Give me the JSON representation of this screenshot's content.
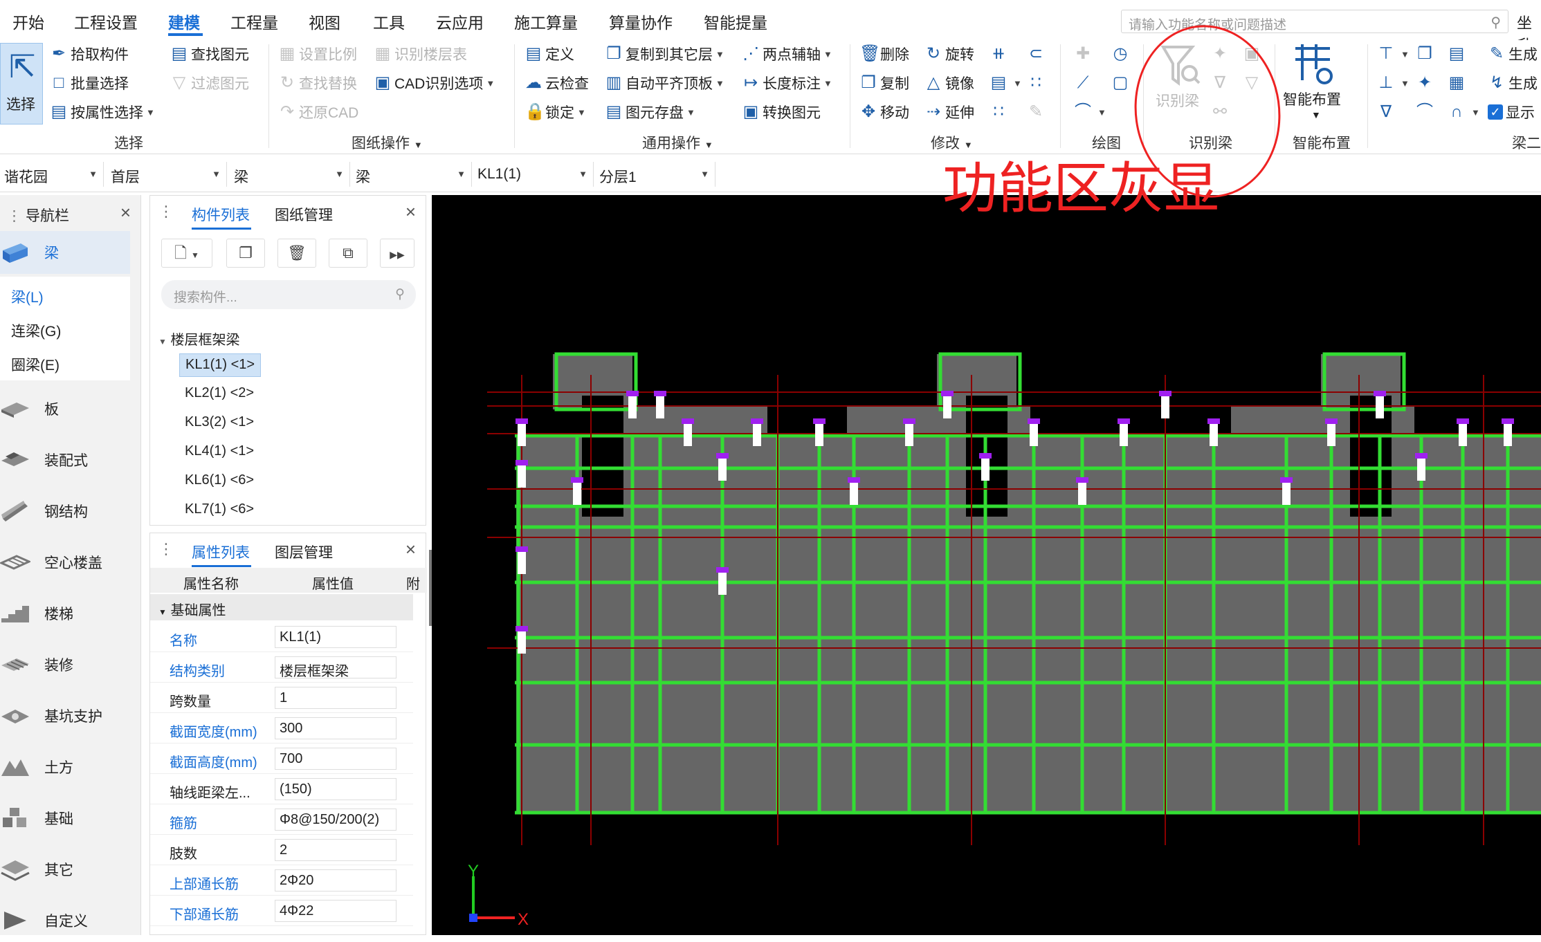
{
  "menu": {
    "items": [
      "开始",
      "工程设置",
      "建模",
      "工程量",
      "视图",
      "工具",
      "云应用",
      "施工算量",
      "算量协作",
      "智能提量"
    ],
    "active_index": 2,
    "search_placeholder": "请输入功能名称或问题描述",
    "right_label": "坐升"
  },
  "ribbon": {
    "select_group": {
      "big_button": "选择",
      "buttons": [
        "拾取构件",
        "批量选择",
        "按属性选择"
      ],
      "label": "选择"
    },
    "find_group": {
      "buttons": [
        "查找图元",
        "过滤图元"
      ]
    },
    "drawing_group": {
      "buttons": [
        "设置比例",
        "识别楼层表",
        "查找替换",
        "CAD识别选项",
        "还原CAD"
      ],
      "label": "图纸操作"
    },
    "common_group": {
      "buttons": [
        "定义",
        "复制到其它层",
        "两点辅轴",
        "云检查",
        "自动平齐顶板",
        "长度标注",
        "锁定",
        "图元存盘",
        "转换图元"
      ],
      "label": "通用操作"
    },
    "modify_group": {
      "buttons": [
        "删除",
        "旋转",
        "复制",
        "镜像",
        "移动",
        "延伸"
      ],
      "label": "修改"
    },
    "draw_group": {
      "label": "绘图"
    },
    "recognize_group": {
      "big_button": "识别梁",
      "label": "识别梁"
    },
    "smart_group": {
      "big_button": "智能布置",
      "label": "智能布置"
    },
    "beam2_group": {
      "buttons": [
        "生成",
        "生成",
        "显示"
      ],
      "label": "梁二"
    }
  },
  "selectors": [
    "谐花园",
    "首层",
    "梁",
    "梁",
    "KL1(1)",
    "分层1"
  ],
  "nav": {
    "title": "导航栏",
    "items": [
      "梁",
      "板",
      "装配式",
      "钢结构",
      "空心楼盖",
      "楼梯",
      "装修",
      "基坑支护",
      "土方",
      "基础",
      "其它",
      "自定义"
    ],
    "sub_items": [
      "梁(L)",
      "连梁(G)",
      "圈梁(E)"
    ]
  },
  "component_list": {
    "tabs": [
      "构件列表",
      "图纸管理"
    ],
    "search_placeholder": "搜索构件...",
    "tree_root": "楼层框架梁",
    "items": [
      "KL1(1) <1>",
      "KL2(1) <2>",
      "KL3(2) <1>",
      "KL4(1) <1>",
      "KL6(1) <6>",
      "KL7(1) <6>"
    ],
    "selected_index": 0
  },
  "property_list": {
    "tabs": [
      "属性列表",
      "图层管理"
    ],
    "columns": [
      "属性名称",
      "属性值",
      "附"
    ],
    "group": "基础属性",
    "rows": [
      {
        "name": "名称",
        "value": "KL1(1)",
        "blue": true
      },
      {
        "name": "结构类别",
        "value": "楼层框架梁",
        "blue": true
      },
      {
        "name": "跨数量",
        "value": "1",
        "blue": false
      },
      {
        "name": "截面宽度(mm)",
        "value": "300",
        "blue": true
      },
      {
        "name": "截面高度(mm)",
        "value": "700",
        "blue": true
      },
      {
        "name": "轴线距梁左...",
        "value": "(150)",
        "blue": false
      },
      {
        "name": "箍筋",
        "value": "Φ8@150/200(2)",
        "blue": true
      },
      {
        "name": "肢数",
        "value": "2",
        "blue": false
      },
      {
        "name": "上部通长筋",
        "value": "2Φ20",
        "blue": true
      },
      {
        "name": "下部通长筋",
        "value": "4Φ22",
        "blue": true
      }
    ]
  },
  "canvas": {
    "axis_x": "X",
    "axis_y": "Y",
    "colors": {
      "beam": "#33dd33",
      "column": "#a020f0",
      "slab": "#666666",
      "grid": "#8b0000"
    }
  },
  "annotation": {
    "text": "功能区灰显",
    "color": "#ee2222"
  }
}
